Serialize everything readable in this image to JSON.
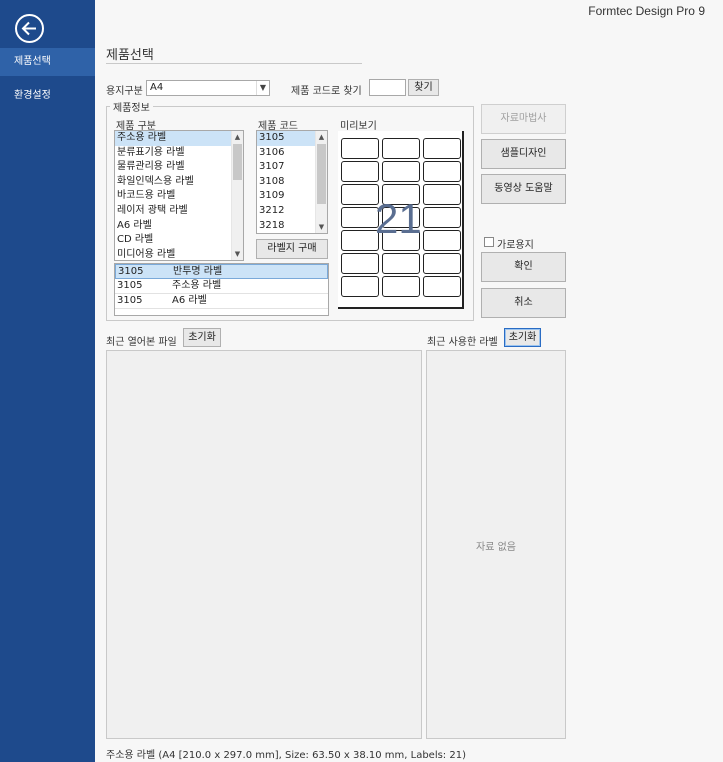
{
  "app_title": "Formtec Design Pro 9",
  "sidebar": {
    "items": [
      {
        "label": "제품선택"
      },
      {
        "label": "환경설정"
      }
    ]
  },
  "page_title": "제품선택",
  "paper_type": {
    "label": "용지구분",
    "value": "A4"
  },
  "code_search": {
    "label": "제품 코드로 찾기",
    "value": "",
    "button": "찾기"
  },
  "product_info": {
    "legend": "제품정보",
    "category_label": "제품 구분",
    "categories": [
      "주소용 라벨",
      "분류표기용 라벨",
      "물류관리용 라벨",
      "화일인덱스용 라벨",
      "바코드용 라벨",
      "레이저 광택 라벨",
      "A6 라벨",
      "CD 라벨",
      "미디어용 라벨"
    ],
    "code_label": "제품 코드",
    "codes": [
      "3105",
      "3106",
      "3107",
      "3108",
      "3109",
      "3212",
      "3218"
    ],
    "buy_button": "라벨지 구매",
    "preview_label": "미리보기",
    "preview_count": "21",
    "results": [
      {
        "code": "3105",
        "name": "반투명 라벨"
      },
      {
        "code": "3105",
        "name": "주소용 라벨"
      },
      {
        "code": "3105",
        "name": "A6 라벨"
      }
    ]
  },
  "actions": {
    "merge": "자료마법사",
    "sample": "샘플디자인",
    "video": "동영상 도움말",
    "landscape": "가로용지",
    "ok": "확인",
    "cancel": "취소"
  },
  "recent_files": {
    "label": "최근 열어본 파일",
    "reset": "초기화"
  },
  "recent_labels": {
    "label": "최근 사용한 라벨",
    "reset": "초기화",
    "empty": "자료 없음"
  },
  "status_text": "주소용 라벨 (A4 [210.0 x 297.0 mm], Size: 63.50 x 38.10 mm, Labels: 21)"
}
